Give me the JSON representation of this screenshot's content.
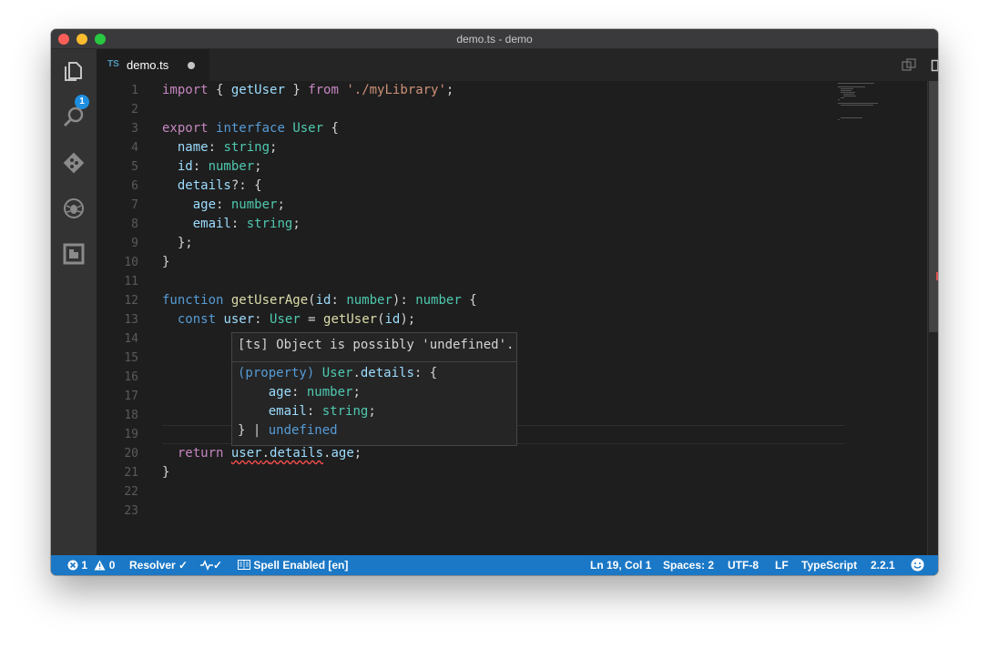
{
  "window": {
    "title": "demo.ts - demo"
  },
  "activity": {
    "explorer_badge": "1"
  },
  "tab": {
    "lang": "TS",
    "name": "demo.ts"
  },
  "gutter": {
    "lines": [
      "1",
      "2",
      "3",
      "4",
      "5",
      "6",
      "7",
      "8",
      "9",
      "10",
      "11",
      "12",
      "13",
      "14",
      "15",
      "16",
      "17",
      "18",
      "19",
      "20",
      "21",
      "22",
      "23"
    ]
  },
  "code": {
    "l1": {
      "a": "import",
      "b": " { ",
      "c": "getUser",
      "d": " } ",
      "e": "from",
      "f": " ",
      "g": "'./myLibrary'",
      "h": ";"
    },
    "l3": {
      "a": "export",
      "b": " ",
      "c": "interface",
      "d": " ",
      "e": "User",
      "f": " {"
    },
    "l4": {
      "a": "  ",
      "b": "name",
      "c": ": ",
      "d": "string",
      "e": ";"
    },
    "l5": {
      "a": "  ",
      "b": "id",
      "c": ": ",
      "d": "number",
      "e": ";"
    },
    "l6": {
      "a": "  ",
      "b": "details",
      "c": "?: {"
    },
    "l7": {
      "a": "    ",
      "b": "age",
      "c": ": ",
      "d": "number",
      "e": ";"
    },
    "l8": {
      "a": "    ",
      "b": "email",
      "c": ": ",
      "d": "string",
      "e": ";"
    },
    "l9": {
      "a": "  };"
    },
    "l10": {
      "a": "}"
    },
    "l12": {
      "a": "function",
      "b": " ",
      "c": "getUserAge",
      "d": "(",
      "e": "id",
      "f": ": ",
      "g": "number",
      "h": "): ",
      "i": "number",
      "j": " {"
    },
    "l13": {
      "a": "  ",
      "b": "const",
      "c": " ",
      "d": "user",
      "e": ": ",
      "f": "User",
      "g": " = ",
      "h": "getUser",
      "i": "(",
      "j": "id",
      "k": ");"
    },
    "l20": {
      "a": "  ",
      "b": "return",
      "c": " ",
      "d": "user",
      "e": ".",
      "f": "details",
      "g": ".",
      "h": "age",
      "i": ";"
    },
    "l21": {
      "a": "}"
    }
  },
  "hover": {
    "message": "[ts] Object is possibly 'undefined'.",
    "sig_a": "(property) ",
    "sig_b": "User",
    "sig_c": ".",
    "sig_d": "details",
    "sig_e": ": {",
    "age_a": "    ",
    "age_b": "age",
    "age_c": ": ",
    "age_d": "number",
    "age_e": ";",
    "email_a": "    ",
    "email_b": "email",
    "email_c": ": ",
    "email_d": "string",
    "email_e": ";",
    "end_a": "} | ",
    "end_b": "undefined"
  },
  "status": {
    "errors": "1",
    "warnings": "0",
    "resolver": "Resolver ✓",
    "pulse": "✓",
    "spell": "Spell Enabled [en]",
    "position": "Ln 19, Col 1",
    "spaces": "Spaces: 2",
    "encoding": "UTF-8",
    "eol": "LF",
    "language": "TypeScript",
    "version": "2.2.1"
  },
  "colors": {
    "statusbar": "#1b78c6",
    "keyword": "#c586c0",
    "type": "#4ec9b0",
    "function": "#dcdcaa",
    "variable": "#9cdcfe",
    "string": "#ce9178"
  }
}
